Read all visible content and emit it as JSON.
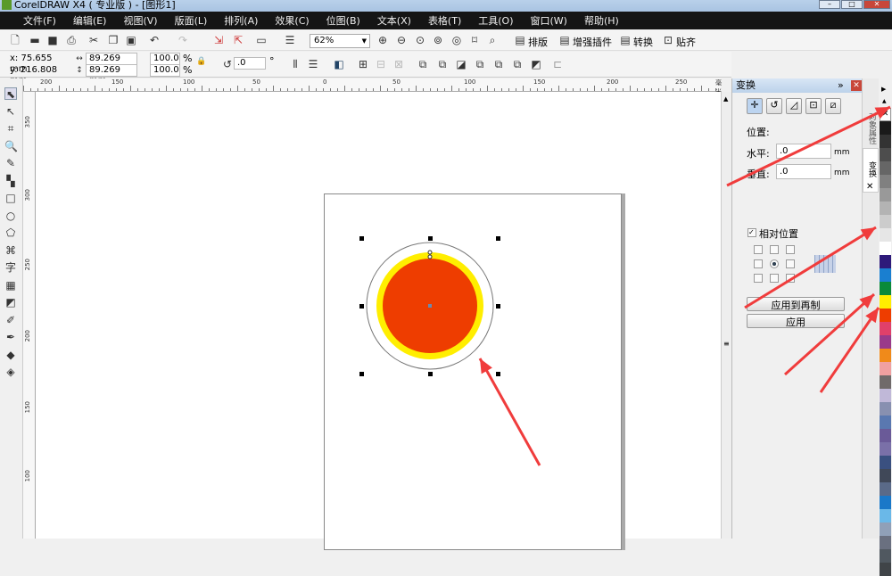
{
  "window": {
    "title": "CorelDRAW X4 ( 专业版 ) - [图形1]"
  },
  "menu": [
    "文件(F)",
    "编辑(E)",
    "视图(V)",
    "版面(L)",
    "排列(A)",
    "效果(C)",
    "位图(B)",
    "文本(X)",
    "表格(T)",
    "工具(O)",
    "窗口(W)",
    "帮助(H)"
  ],
  "toolbar": {
    "zoom": "62%",
    "plugins": [
      "排版",
      "增强插件",
      "转换",
      "贴齐"
    ]
  },
  "property_bar": {
    "x": "x: 75.655 mm",
    "y": "y: 216.808 mm",
    "width": "89.269 mm",
    "height": "89.269 mm",
    "scale_x": "100.0",
    "scale_y": "100.0",
    "percent": "%",
    "angle": ".0",
    "degree": "°"
  },
  "rulers": {
    "horizontal": [
      "200",
      "150",
      "100",
      "50",
      "0",
      "50",
      "100",
      "150",
      "200",
      "250"
    ],
    "unit": "毫米",
    "vertical": [
      "350",
      "300",
      "250",
      "200",
      "150",
      "100"
    ]
  },
  "docker": {
    "title": "变换",
    "section": "位置:",
    "h_label": "水平:",
    "h_value": ".0",
    "v_label": "垂直:",
    "v_value": ".0",
    "unit": "mm",
    "relative": "相对位置",
    "relative_checked": true,
    "apply_copy": "应用到再制",
    "apply": "应用",
    "tabs": [
      "对象属性",
      "变换"
    ]
  },
  "shapes": {
    "outer_stroke": "#777777",
    "yellow": "#ffee00",
    "red": "#ee3d00"
  },
  "palette": [
    "#1a1a1a",
    "#333333",
    "#4d4d4d",
    "#666666",
    "#808080",
    "#999999",
    "#b3b3b3",
    "#cccccc",
    "#e6e6e6",
    "#ffffff",
    "#2e1a7a",
    "#1a7fd0",
    "#0a8a3a",
    "#ffee00",
    "#ee3d00",
    "#e0406a",
    "#9a3a8a",
    "#f08a1a",
    "#f0a0a0",
    "#706a6a",
    "#c0b8d8",
    "#8890b0",
    "#5a78b0",
    "#6a5a98",
    "#7a70a8",
    "#3a5080",
    "#404858",
    "#5a6a88",
    "#1a78c8",
    "#6ab8e8",
    "#90a0b8",
    "#6a7080",
    "#505860",
    "#404448"
  ],
  "annotation_color": "#f03c3c"
}
